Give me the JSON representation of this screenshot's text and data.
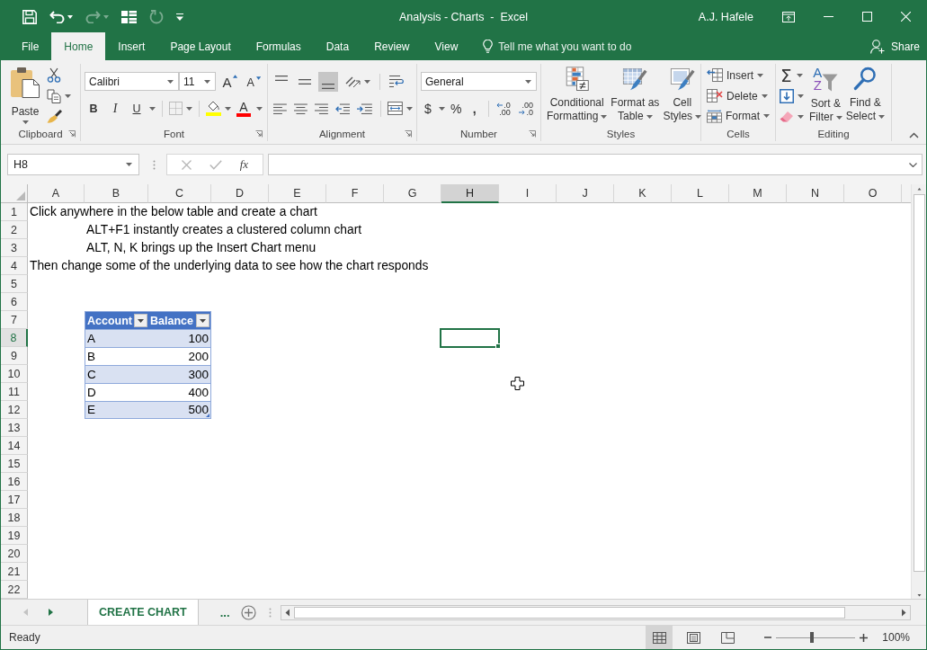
{
  "window": {
    "title": "Analysis - Charts  -  Excel",
    "user": "A.J. Hafele"
  },
  "quick_access": [
    {
      "kind": "save",
      "disabled": false
    },
    {
      "kind": "undo",
      "disabled": false
    },
    {
      "kind": "redo",
      "disabled": true
    },
    {
      "kind": "form",
      "disabled": false
    },
    {
      "kind": "refresh",
      "disabled": true
    },
    {
      "kind": "customize",
      "disabled": false
    }
  ],
  "ribbon_tabs": [
    {
      "label": "File",
      "selected": false
    },
    {
      "label": "Home",
      "selected": true
    },
    {
      "label": "Insert",
      "selected": false
    },
    {
      "label": "Page Layout",
      "selected": false
    },
    {
      "label": "Formulas",
      "selected": false
    },
    {
      "label": "Data",
      "selected": false
    },
    {
      "label": "Review",
      "selected": false
    },
    {
      "label": "View",
      "selected": false
    }
  ],
  "tell_me": {
    "placeholder": "Tell me what you want to do"
  },
  "share": {
    "label": "Share"
  },
  "ribbon": {
    "clipboard": {
      "label": "Clipboard",
      "paste": "Paste"
    },
    "font": {
      "label": "Font",
      "name": "Calibri",
      "size": "11",
      "grow": "A",
      "shrink": "A",
      "bold": "B",
      "italic": "I",
      "underline": "U",
      "font_color_letter": "A"
    },
    "alignment": {
      "label": "Alignment",
      "vertical": [
        {
          "kind": "top",
          "selected": false
        },
        {
          "kind": "middle",
          "selected": false
        },
        {
          "kind": "bottom",
          "selected": true
        }
      ]
    },
    "number": {
      "label": "Number",
      "format": "General",
      "currency": "$",
      "percent": "%",
      "comma": ",",
      "decimals": [
        {
          "kind": "increase",
          "top": ".0",
          "bottom": ".00"
        },
        {
          "kind": "decrease",
          "top": ".00",
          "bottom": ".0"
        }
      ]
    },
    "styles": {
      "label": "Styles",
      "buttons": [
        {
          "kind": "conditional",
          "lines": [
            "Conditional",
            "Formatting"
          ]
        },
        {
          "kind": "table",
          "lines": [
            "Format as",
            "Table"
          ]
        },
        {
          "kind": "cell",
          "lines": [
            "Cell",
            "Styles"
          ]
        }
      ]
    },
    "cells": {
      "label": "Cells",
      "buttons": [
        {
          "kind": "insert",
          "label": "Insert"
        },
        {
          "kind": "delete",
          "label": "Delete"
        },
        {
          "kind": "format",
          "label": "Format"
        }
      ]
    },
    "editing": {
      "label": "Editing",
      "autosum": "Σ",
      "buttons": [
        {
          "kind": "sort",
          "lines": [
            "Sort &",
            "Filter"
          ],
          "icon_letters": [
            "A",
            "Z"
          ]
        },
        {
          "kind": "find",
          "lines": [
            "Find &",
            "Select"
          ]
        }
      ]
    }
  },
  "formula_bar": {
    "name_box": "H8",
    "function_label": "fx"
  },
  "sheet": {
    "columns": [
      {
        "label": "A",
        "selected": false
      },
      {
        "label": "B",
        "selected": false
      },
      {
        "label": "C",
        "selected": false
      },
      {
        "label": "D",
        "selected": false
      },
      {
        "label": "E",
        "selected": false
      },
      {
        "label": "F",
        "selected": false
      },
      {
        "label": "G",
        "selected": false
      },
      {
        "label": "H",
        "selected": true
      },
      {
        "label": "I",
        "selected": false
      },
      {
        "label": "J",
        "selected": false
      },
      {
        "label": "K",
        "selected": false
      },
      {
        "label": "L",
        "selected": false
      },
      {
        "label": "M",
        "selected": false
      },
      {
        "label": "N",
        "selected": false
      },
      {
        "label": "O",
        "selected": false
      }
    ],
    "rows": [
      {
        "label": "1",
        "selected": false
      },
      {
        "label": "2",
        "selected": false
      },
      {
        "label": "3",
        "selected": false
      },
      {
        "label": "4",
        "selected": false
      },
      {
        "label": "5",
        "selected": false
      },
      {
        "label": "6",
        "selected": false
      },
      {
        "label": "7",
        "selected": false
      },
      {
        "label": "8",
        "selected": true
      },
      {
        "label": "9",
        "selected": false
      },
      {
        "label": "10",
        "selected": false
      },
      {
        "label": "11",
        "selected": false
      },
      {
        "label": "12",
        "selected": false
      },
      {
        "label": "13",
        "selected": false
      },
      {
        "label": "14",
        "selected": false
      },
      {
        "label": "15",
        "selected": false
      },
      {
        "label": "16",
        "selected": false
      },
      {
        "label": "17",
        "selected": false
      },
      {
        "label": "18",
        "selected": false
      },
      {
        "label": "19",
        "selected": false
      },
      {
        "label": "20",
        "selected": false
      },
      {
        "label": "21",
        "selected": false
      },
      {
        "label": "22",
        "selected": false
      }
    ],
    "notes": [
      {
        "kind": "plain",
        "text": "Click anywhere in the below table and create a chart"
      },
      {
        "kind": "indented",
        "text": "ALT+F1 instantly creates a clustered column chart"
      },
      {
        "kind": "indented",
        "text": "ALT, N, K brings up the Insert Chart menu"
      },
      {
        "kind": "plain",
        "text": "Then change some of the underlying data to see how the chart responds"
      }
    ],
    "table": {
      "columns": [
        {
          "label": "Account",
          "kind": "text",
          "filter": true
        },
        {
          "label": "Balance",
          "kind": "number",
          "filter": true
        }
      ],
      "rows": [
        [
          "A",
          "100"
        ],
        [
          "B",
          "200"
        ],
        [
          "C",
          "300"
        ],
        [
          "D",
          "400"
        ],
        [
          "E",
          "500"
        ]
      ]
    }
  },
  "sheet_tabs": [
    {
      "label": "CREATE CHART",
      "selected": true
    }
  ],
  "more_sheets": "...",
  "status_bar": {
    "status": "Ready",
    "views": [
      {
        "kind": "normal",
        "selected": true
      },
      {
        "kind": "page_layout",
        "selected": false
      },
      {
        "kind": "page_break",
        "selected": false
      }
    ],
    "zoom": {
      "level": 0.45,
      "label": "100%"
    }
  }
}
